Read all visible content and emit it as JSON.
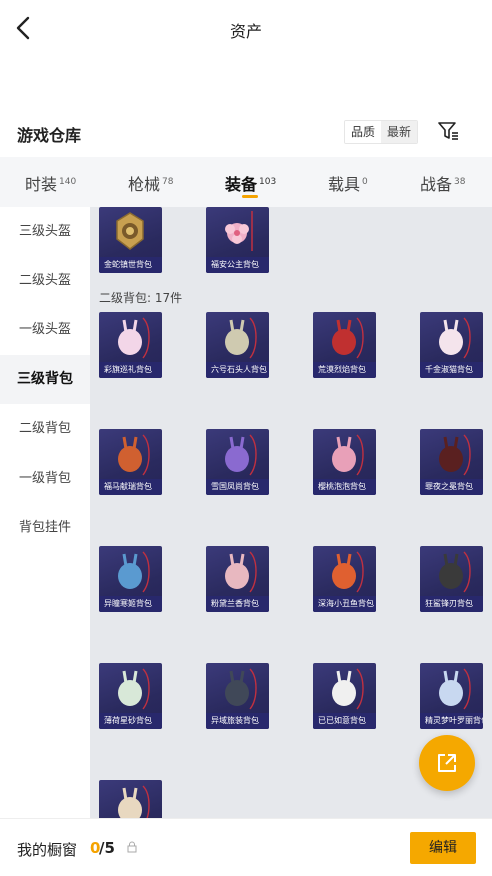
{
  "header": {
    "title": "资产"
  },
  "warehouse": {
    "title": "游戏仓库",
    "sort_options": [
      "品质",
      "最新"
    ],
    "active_sort": 1
  },
  "tabs": [
    {
      "label": "时装",
      "count": "140"
    },
    {
      "label": "枪械",
      "count": "78"
    },
    {
      "label": "装备",
      "count": "103",
      "active": true
    },
    {
      "label": "载具",
      "count": "0"
    },
    {
      "label": "战备",
      "count": "38"
    }
  ],
  "sidebar": {
    "items": [
      "三级头盔",
      "二级头盔",
      "一级头盔",
      "三级背包",
      "二级背包",
      "一级背包",
      "背包挂件"
    ],
    "active_index": 3
  },
  "content": {
    "top_items": [
      {
        "name": "金蛇镇世背包",
        "icon": "gold-snake-badge-icon"
      },
      {
        "name": "福安公主背包",
        "icon": "pink-flower-pouch-icon"
      }
    ],
    "group_label": "二级背包: 17件",
    "items": [
      {
        "name": "彩旗巡礼背包",
        "color": "#f3d6e8"
      },
      {
        "name": "六号石头人背包",
        "color": "#cfcab0"
      },
      {
        "name": "荒漠烈焰背包",
        "color": "#c03030"
      },
      {
        "name": "千金淑猫背包",
        "color": "#f4e4ec"
      },
      {
        "name": "福马献瑞背包",
        "color": "#d06030"
      },
      {
        "name": "雪国凤尚背包",
        "color": "#8a6ad0"
      },
      {
        "name": "樱桃泡泡背包",
        "color": "#e8a0b8"
      },
      {
        "name": "罪夜之冕背包",
        "color": "#5a2020"
      },
      {
        "name": "异瞳寒姬背包",
        "color": "#5a9ad0"
      },
      {
        "name": "粉黛兰香背包",
        "color": "#e8b8c0"
      },
      {
        "name": "深海小丑鱼背包",
        "color": "#e06030"
      },
      {
        "name": "狂鲨锋刃背包",
        "color": "#3a3a3a"
      },
      {
        "name": "薄荷星砂背包",
        "color": "#d8e8d8"
      },
      {
        "name": "异域旅装背包",
        "color": "#404858"
      },
      {
        "name": "已已如意背包",
        "color": "#f0f0f0"
      },
      {
        "name": "精灵梦叶罗丽背包",
        "color": "#c8d8f0"
      },
      {
        "name": "",
        "color": "#e8d8c0"
      }
    ]
  },
  "footer": {
    "showcase_label": "我的橱窗",
    "showcase_current": "0",
    "showcase_total": "/5",
    "edit_label": "编辑"
  }
}
